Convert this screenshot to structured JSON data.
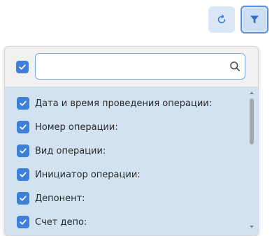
{
  "toolbar": {
    "refresh_icon": "refresh-icon",
    "filter_icon": "filter-icon"
  },
  "filter_panel": {
    "select_all_checked": true,
    "search": {
      "value": "",
      "placeholder": "",
      "icon": "search-icon"
    },
    "items": [
      {
        "label": "Дата и время проведения операции:",
        "checked": true
      },
      {
        "label": "Номер операции:",
        "checked": true
      },
      {
        "label": "Вид операции:",
        "checked": true
      },
      {
        "label": "Инициатор операции:",
        "checked": true
      },
      {
        "label": "Депонент:",
        "checked": true
      },
      {
        "label": "Счет депо:",
        "checked": true
      }
    ]
  },
  "colors": {
    "accent": "#3d7fd9",
    "list_background": "#d3e2f1",
    "button_background": "#dbe7f6",
    "header_background": "#f1f1f1"
  }
}
